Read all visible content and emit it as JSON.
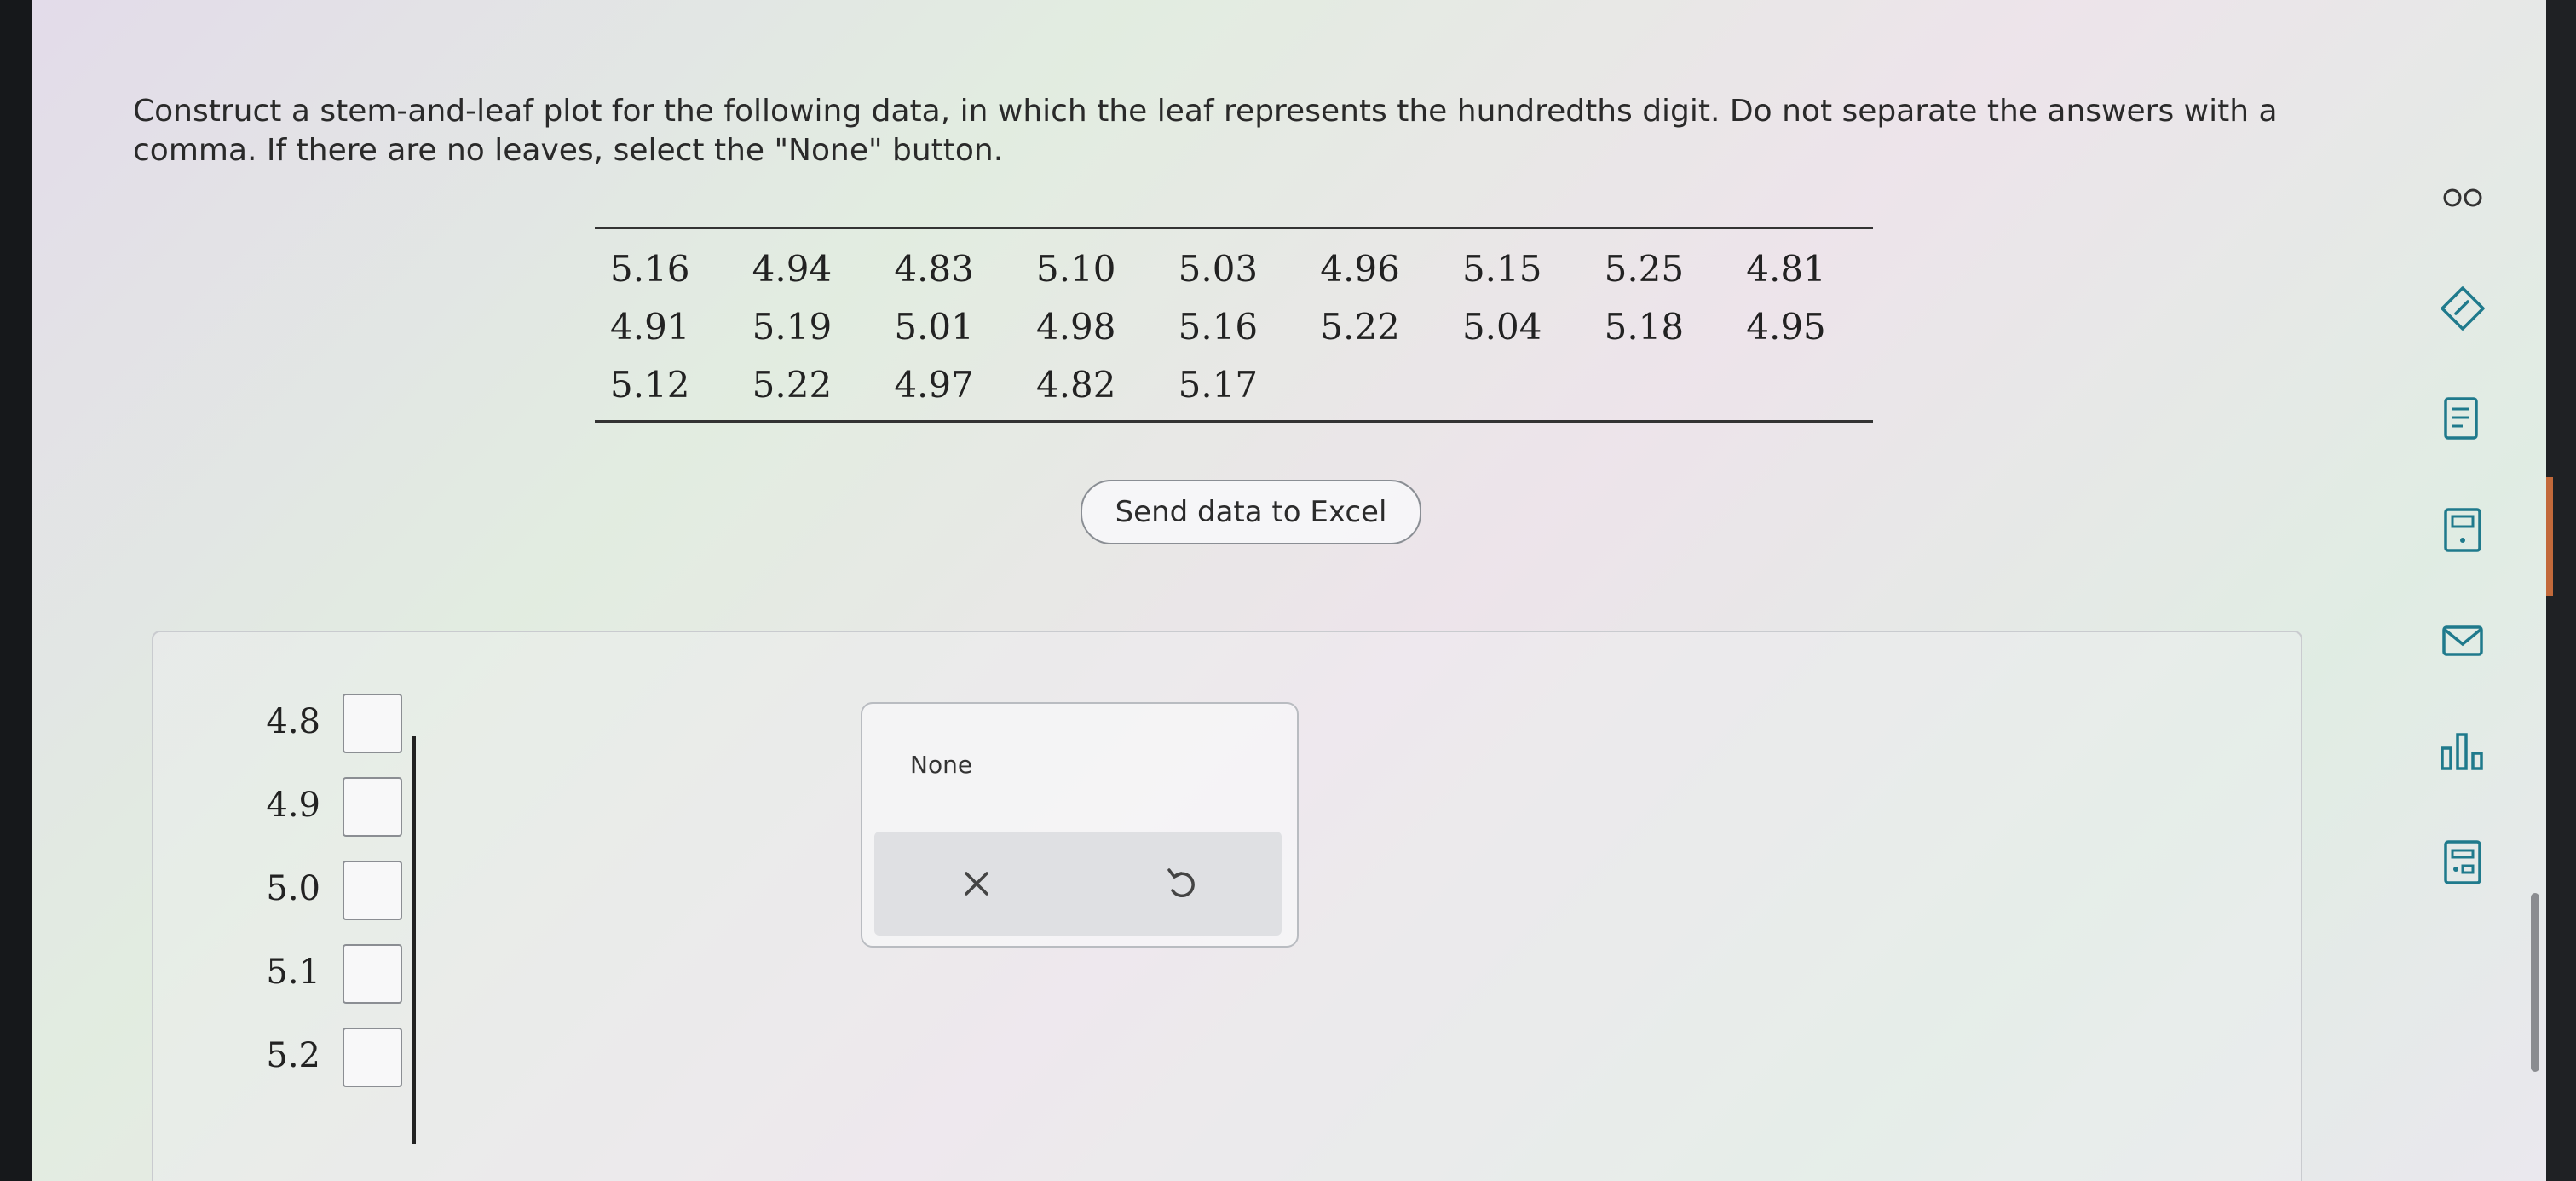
{
  "question": {
    "text": "Construct a stem-and-leaf plot for the following data, in which the leaf represents the hundredths digit. Do not separate the answers with a comma. If there are no leaves, select the \"None\" button."
  },
  "data_table": {
    "rows": [
      [
        "5.16",
        "4.94",
        "4.83",
        "5.10",
        "5.03",
        "4.96",
        "5.15",
        "5.25",
        "4.81"
      ],
      [
        "4.91",
        "5.19",
        "5.01",
        "4.98",
        "5.16",
        "5.22",
        "5.04",
        "5.18",
        "4.95"
      ],
      [
        "5.12",
        "5.22",
        "4.97",
        "4.82",
        "5.17",
        "",
        "",
        "",
        ""
      ]
    ]
  },
  "excel_button": {
    "label": "Send data to Excel"
  },
  "stem_plot": {
    "stems": [
      "4.8",
      "4.9",
      "5.0",
      "5.1",
      "5.2"
    ],
    "leaves": [
      "",
      "",
      "",
      "",
      ""
    ]
  },
  "tool_panel": {
    "none_label": "None",
    "clear_icon": "close-icon",
    "undo_icon": "undo-icon"
  },
  "sidebar": {
    "icons": [
      "infinity-icon",
      "pencil-tag-icon",
      "notes-icon",
      "calculator-icon",
      "mail-icon",
      "bar-chart-icon",
      "data-card-icon"
    ]
  },
  "colors": {
    "text": "#2a2a2a",
    "border": "#8b8e93",
    "icon": "#1f7a8c"
  }
}
